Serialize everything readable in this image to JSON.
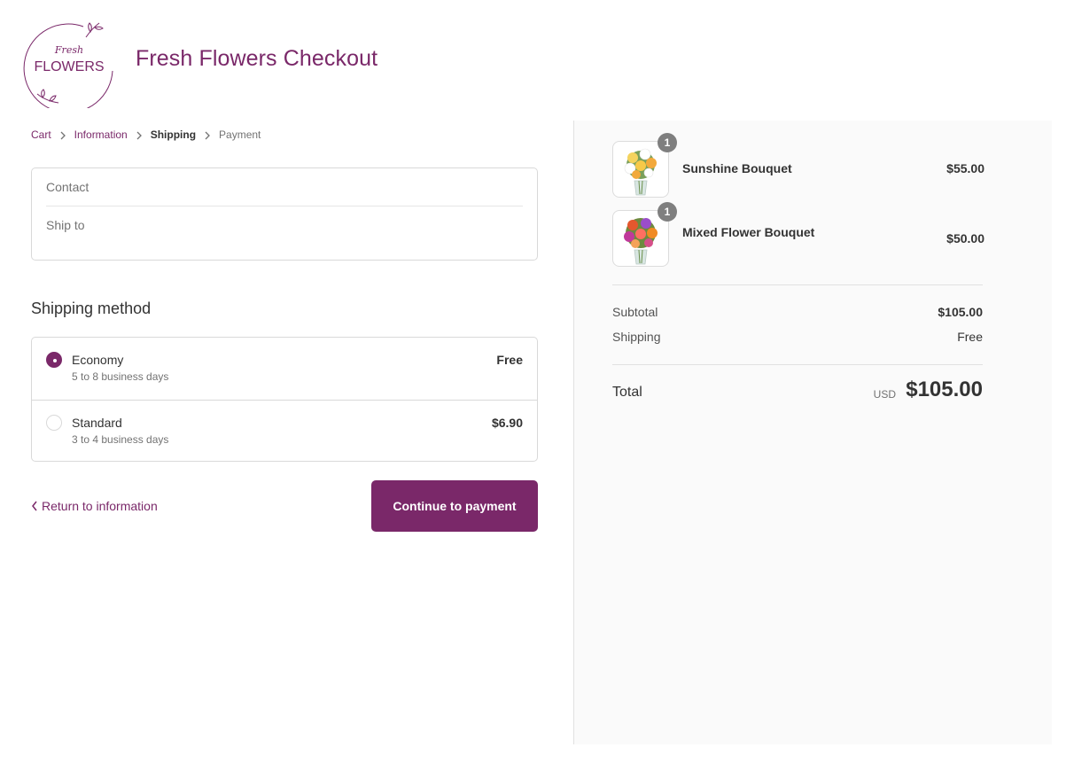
{
  "header": {
    "logo_script": "Fresh",
    "logo_word": "FLOWERS",
    "title": "Fresh Flowers Checkout"
  },
  "breadcrumb": [
    {
      "label": "Cart",
      "state": "link"
    },
    {
      "label": "Information",
      "state": "link"
    },
    {
      "label": "Shipping",
      "state": "current"
    },
    {
      "label": "Payment",
      "state": "upcoming"
    }
  ],
  "review": {
    "contact_label": "Contact",
    "ship_to_label": "Ship to"
  },
  "shipping": {
    "title": "Shipping method",
    "methods": [
      {
        "name": "Economy",
        "description": "5 to 8 business days",
        "price": "Free",
        "selected": true
      },
      {
        "name": "Standard",
        "description": "3 to 4 business days",
        "price": "$6.90",
        "selected": false
      }
    ]
  },
  "actions": {
    "return_label": "Return to information",
    "continue_label": "Continue to payment"
  },
  "summary": {
    "items": [
      {
        "name": "Sunshine Bouquet",
        "quantity": "1",
        "price": "$55.00",
        "icon": "sunshine-bouquet-image"
      },
      {
        "name": "Mixed Flower Bouquet",
        "quantity": "1",
        "price": "$50.00",
        "icon": "mixed-flower-bouquet-image"
      }
    ],
    "subtotal_label": "Subtotal",
    "subtotal_value": "$105.00",
    "shipping_label": "Shipping",
    "shipping_value": "Free",
    "total_label": "Total",
    "currency": "USD",
    "total_value": "$105.00"
  },
  "colors": {
    "brand": "#7a2869",
    "panel_bg": "#fafafa",
    "border": "#d9d9d9"
  }
}
